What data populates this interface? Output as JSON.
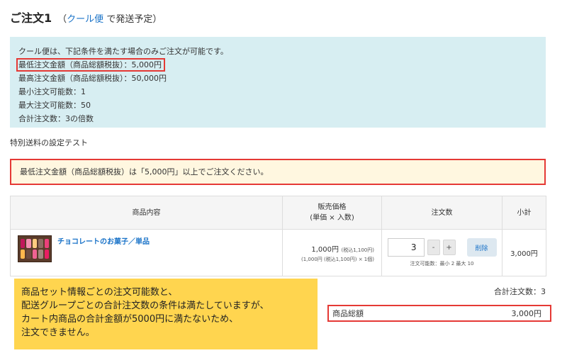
{
  "header": {
    "title": "ご注文1",
    "sub_open": "（",
    "sub_link": "クール便",
    "sub_rest": "で発送予定）"
  },
  "info": {
    "lines": [
      "クール便は、下記条件を満たす場合のみご注文が可能です。",
      "最低注文金額（商品総額税抜）：5,000円",
      "最高注文金額（商品総額税抜）：50,000円",
      "最小注文可能数：1",
      "最大注文可能数：50",
      "合計注文数：3の倍数"
    ]
  },
  "special_label": "特別送料の設定テスト",
  "warning": "最低注文金額（商品総額税抜）は「5,000円」以上でご注文ください。",
  "table": {
    "headers": {
      "product": "商品内容",
      "price_line1": "販売価格",
      "price_line2": "(単価 × 入数)",
      "qty": "注文数",
      "subtotal": "小計"
    },
    "row": {
      "name": "チョコレートのお菓子／単品",
      "price_main": "1,000円",
      "price_tax": "(税込1,100円)",
      "price_sub": "(1,000円 (税込1,100円) × 1個)",
      "qty": "3",
      "minus": "-",
      "plus": "+",
      "delete": "削除",
      "qty_note": "注文可能数：最小 2  最大 10",
      "subtotal": "3,000円"
    }
  },
  "totals": {
    "qty_label": "合計注文数：3",
    "goods_label": "商品総額",
    "goods_value": "3,000円"
  },
  "note": [
    "商品セット情報ごとの注文可能数と、",
    "配送グループごとの合計注文数の条件は満たしていますが、",
    "カート内商品の合計金額が5000円に満たないため、",
    "注文できません。"
  ],
  "colors": {
    "link": "#1a73c8",
    "info_bg": "#d7eef2",
    "warning_bg": "#fff7e0",
    "highlight": "#e53935",
    "note_bg": "#ffd54f"
  }
}
